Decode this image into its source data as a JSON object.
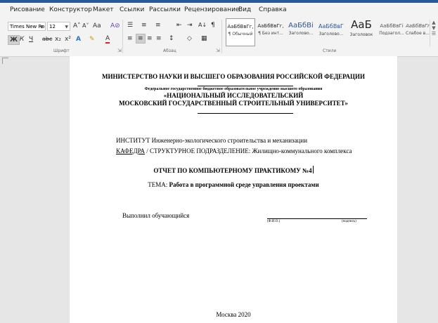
{
  "ribbon": {
    "tabs": [
      "Рисование",
      "Конструктор",
      "Макет",
      "Ссылки",
      "Рассылки",
      "Рецензирование",
      "Вид",
      "Справка"
    ],
    "font": {
      "name": "Times New Ro",
      "size": "12",
      "grow": "A˄",
      "shrink": "A˅",
      "case": "Aa",
      "clear": "A⊘",
      "bold": "Ж",
      "italic": "К",
      "underline": "Ч",
      "strike": "abc",
      "subscript": "x₂",
      "superscript": "x²",
      "effects": "A",
      "highlight": "✎",
      "color": "A",
      "group_label": "Шрифт"
    },
    "paragraph": {
      "bullets": "☰",
      "numbering": "≡",
      "multilevel": "≡",
      "decrease_indent": "⇤",
      "increase_indent": "⇥",
      "sort": "A↓",
      "marks": "¶",
      "align_left": "≡",
      "align_center": "≡",
      "align_right": "≡",
      "justify": "≡",
      "line_spacing": "↕",
      "shading": "◇",
      "borders": "▦",
      "group_label": "Абзац"
    },
    "styles": {
      "items": [
        {
          "sample": "АаБбВвГг,",
          "name": "¶ Обычный"
        },
        {
          "sample": "АаБбВвГг,",
          "name": "¶ Без инт..."
        },
        {
          "sample": "АаБбВі",
          "name": "Заголово..."
        },
        {
          "sample": "АаБбВвГ",
          "name": "Заголово..."
        },
        {
          "sample": "АаБ",
          "name": "Заголовок"
        },
        {
          "sample": "АаБбВвГі",
          "name": "Подзагол..."
        },
        {
          "sample": "АаБбВвГг,",
          "name": "Слабое в..."
        }
      ],
      "group_label": "Стили"
    }
  },
  "document": {
    "ministry": "МИНИСТЕРСТВО НАУКИ И ВЫСШЕГО ОБРАЗОВАНИЯ РОССИЙСКОЙ ФЕДЕРАЦИИ",
    "institution_type": "Федеральное государственное бюджетное образовательное учреждение высшего образования",
    "university_line1": "«НАЦИОНАЛЬНЫЙ ИССЛЕДОВАТЕЛЬСКИЙ",
    "university_line2": "МОСКОВСКИЙ ГОСУДАРСТВЕННЫЙ СТРОИТЕЛЬНЫЙ УНИВЕРСИТЕТ»",
    "institute": "ИНСТИТУТ Инженерно-экологического строительства и механизации",
    "department_label": "КАФЕДРА",
    "department_rest": " / СТРУКТУРНОЕ ПОДРАЗДЕЛЕНИЕ: Жилищно-коммунального комплекса",
    "report_title": "ОТЧЕТ ПО КОМПЬЮТЕРНОМУ ПРАКТИКОМУ №4",
    "topic_label": "ТЕМА: ",
    "topic_text": "Работа в программной среде управления проектами",
    "performed_by": "Выполнил обучающийся",
    "fio_caption": "(Ф.И.О.)",
    "signature_caption": "(подпись)",
    "city_year": "Москва 2020"
  }
}
